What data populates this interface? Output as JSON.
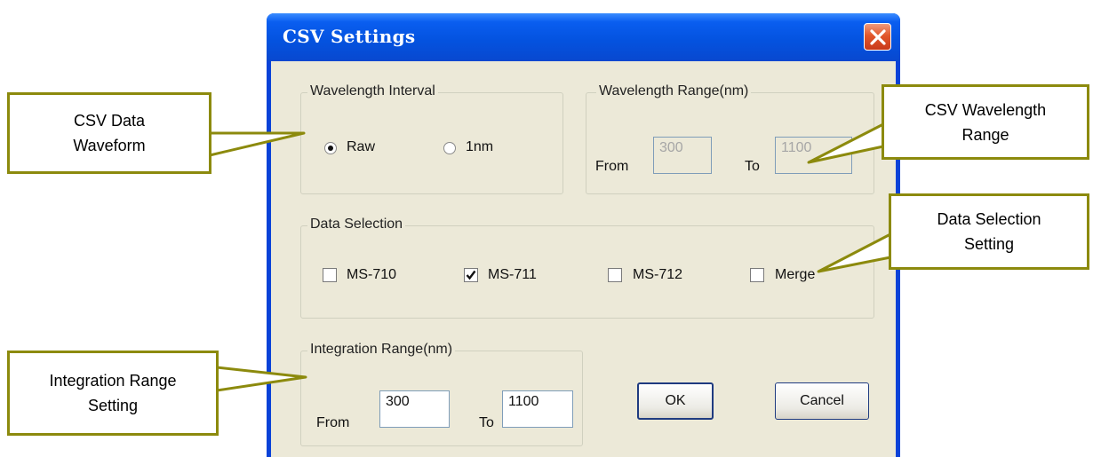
{
  "dialog": {
    "title": "CSV Settings",
    "close_icon": "close-icon"
  },
  "wavelength_interval": {
    "legend": "Wavelength Interval",
    "options": [
      {
        "label": "Raw",
        "selected": true
      },
      {
        "label": "1nm",
        "selected": false
      }
    ]
  },
  "wavelength_range": {
    "legend": "Wavelength Range(nm)",
    "from_label": "From",
    "from_value": "300",
    "to_label": "To",
    "to_value": "1100",
    "enabled": false
  },
  "data_selection": {
    "legend": "Data Selection",
    "items": [
      {
        "label": "MS-710",
        "checked": false
      },
      {
        "label": "MS-711",
        "checked": true
      },
      {
        "label": "MS-712",
        "checked": false
      },
      {
        "label": "Merge",
        "checked": false
      }
    ]
  },
  "integration_range": {
    "legend": "Integration Range(nm)",
    "from_label": "From",
    "from_value": "300",
    "to_label": "To",
    "to_value": "1100"
  },
  "buttons": {
    "ok": "OK",
    "cancel": "Cancel"
  },
  "callouts": {
    "csv_data_waveform": [
      "CSV Data",
      "Waveform"
    ],
    "csv_wavelength_range": [
      "CSV Wavelength",
      "Range"
    ],
    "data_selection_setting": [
      "Data Selection",
      "Setting"
    ],
    "integration_range_setting": [
      "Integration Range",
      "Setting"
    ]
  },
  "colors": {
    "titlebar": "#0453e0",
    "dialog_face": "#ece9d8",
    "callout_border": "#8c8a0d",
    "close_button": "#e2572b"
  }
}
